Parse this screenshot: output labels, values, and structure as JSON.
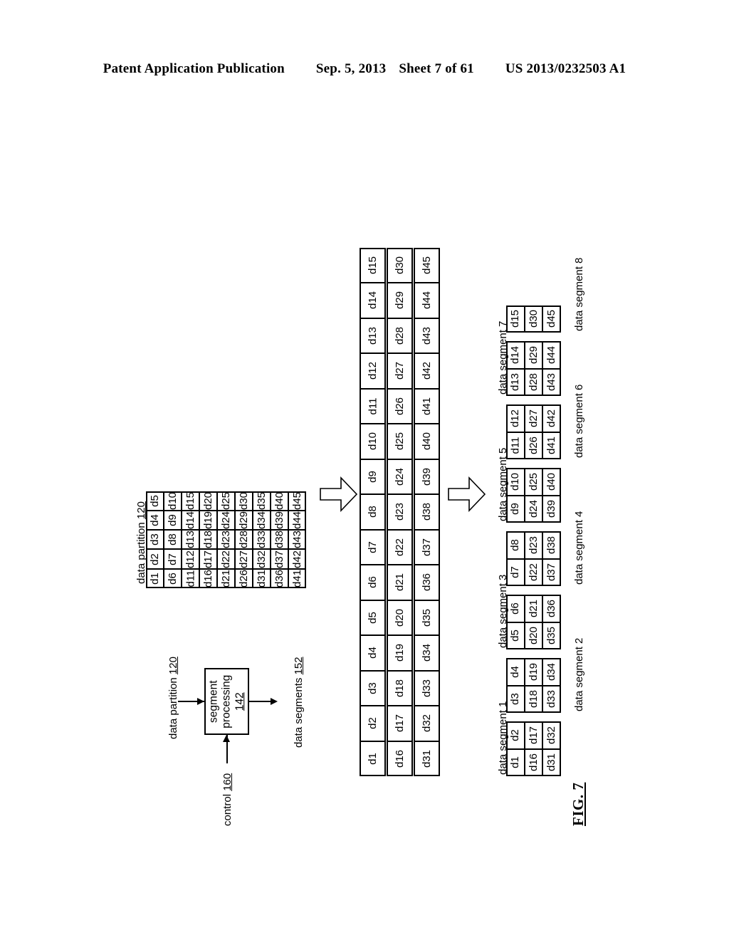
{
  "header": {
    "publication": "Patent Application Publication",
    "date": "Sep. 5, 2013",
    "sheet": "Sheet 7 of 61",
    "patent_number": "US 2013/0232503 A1"
  },
  "figure": {
    "label": "FIG. 7"
  },
  "flow": {
    "input_label": "data partition",
    "input_ref": "120",
    "control_label": "control",
    "control_ref": "160",
    "process_line1": "segment",
    "process_line2": "processing",
    "process_ref": "142",
    "output_label": "data segments",
    "output_ref": "152"
  },
  "partition": {
    "title": "data partition",
    "title_ref": "120",
    "rows": [
      [
        "d1",
        "d2",
        "d3",
        "d4",
        "d5"
      ],
      [
        "d6",
        "d7",
        "d8",
        "d9",
        "d10"
      ],
      [
        "d11",
        "d12",
        "d13",
        "d14",
        "d15"
      ],
      [
        "d16",
        "d17",
        "d18",
        "d19",
        "d20"
      ],
      [
        "d21",
        "d22",
        "d23",
        "d24",
        "d25"
      ],
      [
        "d26",
        "d27",
        "d28",
        "d29",
        "d30"
      ],
      [
        "d31",
        "d32",
        "d33",
        "d34",
        "d35"
      ],
      [
        "d36",
        "d37",
        "d38",
        "d39",
        "d40"
      ],
      [
        "d41",
        "d42",
        "d43",
        "d44",
        "d45"
      ]
    ]
  },
  "strips": [
    [
      "d1",
      "d2",
      "d3",
      "d4",
      "d5",
      "d6",
      "d7",
      "d8",
      "d9",
      "d10",
      "d11",
      "d12",
      "d13",
      "d14",
      "d15"
    ],
    [
      "d16",
      "d17",
      "d18",
      "d19",
      "d20",
      "d21",
      "d22",
      "d23",
      "d24",
      "d25",
      "d26",
      "d27",
      "d28",
      "d29",
      "d30"
    ],
    [
      "d31",
      "d32",
      "d33",
      "d34",
      "d35",
      "d36",
      "d37",
      "d38",
      "d39",
      "d40",
      "d41",
      "d42",
      "d43",
      "d44",
      "d45"
    ]
  ],
  "segments": [
    {
      "label": "data segment 1",
      "label_side": "left",
      "rows": [
        [
          "d1",
          "d2"
        ],
        [
          "d16",
          "d17"
        ],
        [
          "d31",
          "d32"
        ]
      ]
    },
    {
      "label": "data segment 2",
      "label_side": "right",
      "rows": [
        [
          "d3",
          "d4"
        ],
        [
          "d18",
          "d19"
        ],
        [
          "d33",
          "d34"
        ]
      ]
    },
    {
      "label": "data segment 3",
      "label_side": "left",
      "rows": [
        [
          "d5",
          "d6"
        ],
        [
          "d20",
          "d21"
        ],
        [
          "d35",
          "d36"
        ]
      ]
    },
    {
      "label": "data segment 4",
      "label_side": "right",
      "rows": [
        [
          "d7",
          "d8"
        ],
        [
          "d22",
          "d23"
        ],
        [
          "d37",
          "d38"
        ]
      ]
    },
    {
      "label": "data segment 5",
      "label_side": "left",
      "rows": [
        [
          "d9",
          "d10"
        ],
        [
          "d24",
          "d25"
        ],
        [
          "d39",
          "d40"
        ]
      ]
    },
    {
      "label": "data segment 6",
      "label_side": "right",
      "rows": [
        [
          "d11",
          "d12"
        ],
        [
          "d26",
          "d27"
        ],
        [
          "d41",
          "d42"
        ]
      ]
    },
    {
      "label": "data segment 7",
      "label_side": "left",
      "rows": [
        [
          "d13",
          "d14"
        ],
        [
          "d28",
          "d29"
        ],
        [
          "d43",
          "d44"
        ]
      ]
    },
    {
      "label": "data segment 8",
      "label_side": "right",
      "rows": [
        [
          "d15"
        ],
        [
          "d30"
        ],
        [
          "d45"
        ]
      ]
    }
  ]
}
